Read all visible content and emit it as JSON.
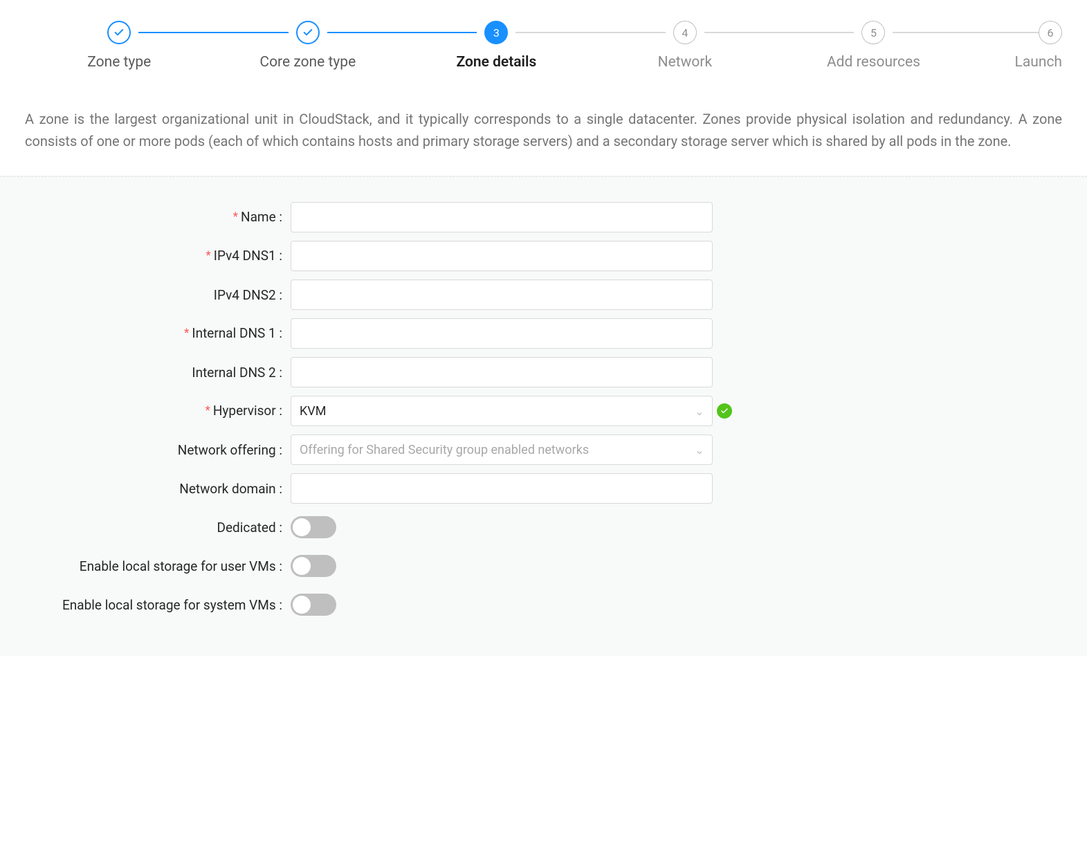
{
  "steps": [
    {
      "label": "Zone type",
      "state": "done",
      "marker": "check"
    },
    {
      "label": "Core zone type",
      "state": "done",
      "marker": "check"
    },
    {
      "label": "Zone details",
      "state": "active",
      "marker": "3"
    },
    {
      "label": "Network",
      "state": "wait",
      "marker": "4"
    },
    {
      "label": "Add resources",
      "state": "wait",
      "marker": "5"
    },
    {
      "label": "Launch",
      "state": "wait",
      "marker": "6"
    }
  ],
  "description": "A zone is the largest organizational unit in CloudStack, and it typically corresponds to a single datacenter. Zones provide physical isolation and redundancy. A zone consists of one or more pods (each of which contains hosts and primary storage servers) and a secondary storage server which is shared by all pods in the zone.",
  "form": {
    "name": {
      "label": "Name",
      "required": true,
      "value": ""
    },
    "ipv4dns1": {
      "label": "IPv4 DNS1",
      "required": true,
      "value": ""
    },
    "ipv4dns2": {
      "label": "IPv4 DNS2",
      "required": false,
      "value": ""
    },
    "internaldns1": {
      "label": "Internal DNS 1",
      "required": true,
      "value": ""
    },
    "internaldns2": {
      "label": "Internal DNS 2",
      "required": false,
      "value": ""
    },
    "hypervisor": {
      "label": "Hypervisor",
      "required": true,
      "value": "KVM",
      "validated": true
    },
    "networkOffering": {
      "label": "Network offering",
      "required": false,
      "value": "Offering for Shared Security group enabled networks"
    },
    "networkDomain": {
      "label": "Network domain",
      "required": false,
      "value": ""
    },
    "dedicated": {
      "label": "Dedicated",
      "value": false
    },
    "localStorageUser": {
      "label": "Enable local storage for user VMs",
      "value": false
    },
    "localStorageSystem": {
      "label": "Enable local storage for system VMs",
      "value": false
    }
  }
}
